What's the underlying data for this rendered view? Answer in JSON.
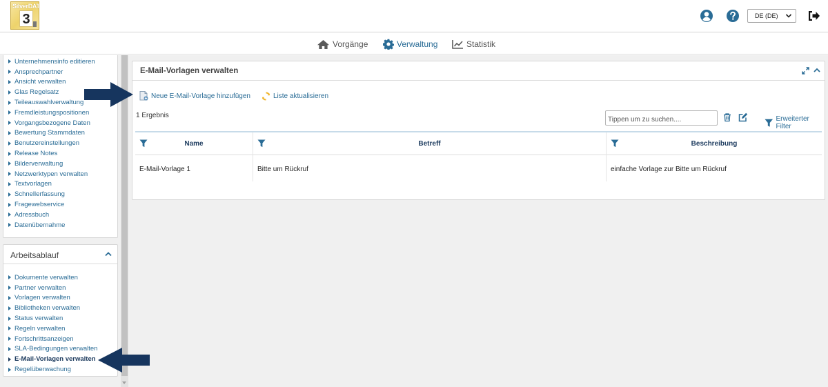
{
  "logo": {
    "brand_silver": "Silver",
    "brand_dat": "DAT",
    "number": "3"
  },
  "header": {
    "language": "DE (DE)"
  },
  "mainnav": [
    {
      "label": "Vorgänge"
    },
    {
      "label": "Verwaltung"
    },
    {
      "label": "Statistik"
    }
  ],
  "sidebar": {
    "items": [
      {
        "label": "Unternehmensinfo editieren"
      },
      {
        "label": "Ansprechpartner"
      },
      {
        "label": "Ansicht verwalten"
      },
      {
        "label": "Glas Regelsatz"
      },
      {
        "label": "Teileauswahlverwaltung"
      },
      {
        "label": "Fremdleistungspositionen"
      },
      {
        "label": "Vorgangsbezogene Daten"
      },
      {
        "label": "Bewertung Stammdaten"
      },
      {
        "label": "Benutzereinstellungen"
      },
      {
        "label": "Release Notes"
      },
      {
        "label": "Bilderverwaltung"
      },
      {
        "label": "Netzwerktypen verwalten"
      },
      {
        "label": "Textvorlagen"
      },
      {
        "label": "Schnellerfassung"
      },
      {
        "label": "Fragewebservice"
      },
      {
        "label": "Adressbuch"
      },
      {
        "label": "Datenübernahme"
      }
    ],
    "workflow": {
      "title": "Arbeitsablauf",
      "items": [
        {
          "label": "Dokumente verwalten"
        },
        {
          "label": "Partner verwalten"
        },
        {
          "label": "Vorlagen verwalten"
        },
        {
          "label": "Bibliotheken verwalten"
        },
        {
          "label": "Status verwalten"
        },
        {
          "label": "Regeln verwalten"
        },
        {
          "label": "Fortschrittsanzeigen"
        },
        {
          "label": "SLA-Bedingungen verwalten"
        },
        {
          "label": "E-Mail-Vorlagen verwalten"
        },
        {
          "label": "Regelüberwachung"
        }
      ]
    }
  },
  "panel": {
    "title": "E-Mail-Vorlagen verwalten",
    "add_label": "Neue E-Mail-Vorlage hinzufügen",
    "refresh_label": "Liste aktualisieren",
    "results": "1 Ergebnis",
    "search_placeholder": "Tippen um zu suchen....",
    "advanced_filter": "Erweiterter Filter",
    "columns": {
      "name": "Name",
      "subject": "Betreff",
      "description": "Beschreibung"
    },
    "rows": [
      {
        "name": "E-Mail-Vorlage 1",
        "subject": "Bitte um Rückruf",
        "description": "einfache Vorlage zur Bitte um Rückruf"
      }
    ]
  },
  "colors": {
    "link": "#2a6c96",
    "navy": "#1f3d60",
    "arrow": "#16355e",
    "refresh": "#f0b42a"
  }
}
